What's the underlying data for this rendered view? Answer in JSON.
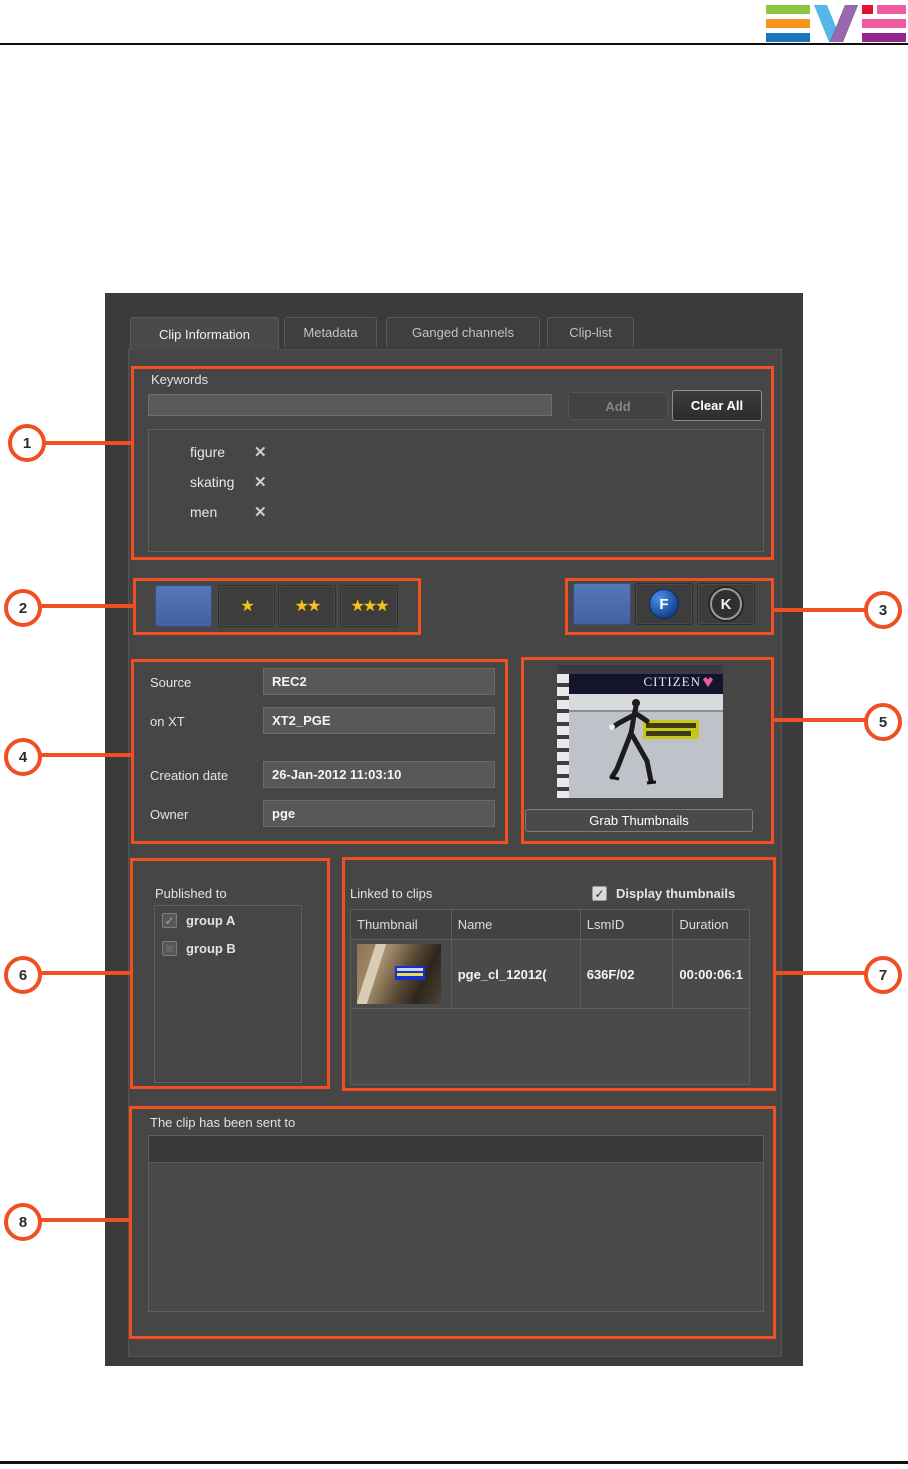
{
  "logo": {
    "name": "EVS logo",
    "letters": [
      "E",
      "V",
      "S"
    ]
  },
  "tabs": [
    {
      "label": "Clip Information",
      "active": true
    },
    {
      "label": "Metadata",
      "active": false
    },
    {
      "label": "Ganged channels",
      "active": false
    },
    {
      "label": "Clip-list",
      "active": false
    }
  ],
  "keywords": {
    "label": "Keywords",
    "input_value": "",
    "add_label": "Add",
    "clear_all_label": "Clear All",
    "items": [
      {
        "text": "figure"
      },
      {
        "text": "skating"
      },
      {
        "text": "men"
      }
    ]
  },
  "icons": {
    "remove": "✕",
    "check": "✓",
    "star1": "★",
    "star2": "★★",
    "star3": "★★★"
  },
  "rating": {
    "selected": "none",
    "options": [
      {
        "label": "",
        "selected": true
      },
      {
        "label": "★",
        "selected": false
      },
      {
        "label": "★★",
        "selected": false
      },
      {
        "label": "★★★",
        "selected": false
      }
    ]
  },
  "flags": {
    "none_selected": true,
    "f_label": "F",
    "k_label": "K"
  },
  "clip_fields": [
    {
      "label": "Source",
      "value": "REC2"
    },
    {
      "label": "on XT",
      "value": "XT2_PGE"
    },
    {
      "label": "Creation date",
      "value": "26-Jan-2012 11:03:10"
    },
    {
      "label": "Owner",
      "value": "pge"
    }
  ],
  "thumbnail": {
    "banner_text": "CITIZEN",
    "caption_box": "yellow on-screen caption",
    "grab_label": "Grab Thumbnails"
  },
  "published": {
    "label": "Published to",
    "groups": [
      {
        "name": "group A",
        "checked": true
      },
      {
        "name": "group B",
        "checked": false
      }
    ]
  },
  "linked": {
    "label": "Linked to clips",
    "display_thumbnails_label": "Display thumbnails",
    "display_thumbnails_checked": true,
    "columns": [
      "Thumbnail",
      "Name",
      "LsmID",
      "Duration"
    ],
    "rows": [
      {
        "name": "pge_cl_12012(",
        "lsmid": "636F/02",
        "duration": "00:00:06:1"
      }
    ]
  },
  "sent": {
    "label": "The clip has been sent to",
    "entries": []
  },
  "callouts": [
    "1",
    "2",
    "3",
    "4",
    "5",
    "6",
    "7",
    "8"
  ],
  "colors": {
    "accent_orange": "#f04e23",
    "panel_dark": "#3b3b3b",
    "panel_content": "#464646",
    "selected_blue": "#4a69ad",
    "star_gold": "#f2c41d"
  }
}
